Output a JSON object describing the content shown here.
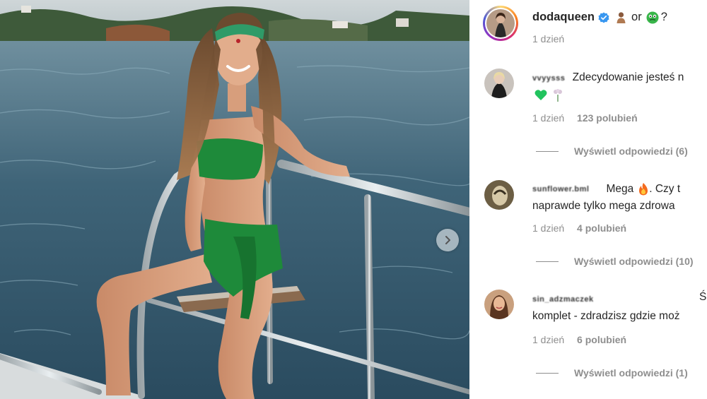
{
  "post": {
    "author": "dodaqueen",
    "verified": true,
    "caption_or": "or",
    "caption_q": "?",
    "caption_emoji_1": "person-emoji",
    "caption_emoji_2": "green-face-emoji",
    "time": "1 dzień"
  },
  "carousel": {
    "next_icon": "chevron-right-icon"
  },
  "comments": [
    {
      "username": "vvyysss",
      "text": "Zdecydowanie jesteś n",
      "emoji_line": [
        "green-heart-emoji",
        "flower-emoji"
      ],
      "time": "1 dzień",
      "likes": "123 polubień",
      "replies": "Wyświetl odpowiedzi (6)"
    },
    {
      "username": "sunflower.bml",
      "text": "Mega",
      "text_after_emoji": ". Czy t",
      "emoji": "fire-emoji",
      "text_line2": "naprawde tylko mega zdrowa",
      "time": "1 dzień",
      "likes": "4 polubień",
      "replies": "Wyświetl odpowiedzi (10)"
    },
    {
      "username": "sin_adzmaczek",
      "text": "Ś",
      "text_line2": "komplet - zdradzisz gdzie moż",
      "time": "1 dzień",
      "likes": "6 polubień",
      "replies": "Wyświetl odpowiedzi (1)"
    }
  ],
  "colors": {
    "accent_green": "#22c35e",
    "verified_blue": "#3897f0",
    "muted_text": "#8e8e8e",
    "bikini_green": "#1e8a3a"
  }
}
